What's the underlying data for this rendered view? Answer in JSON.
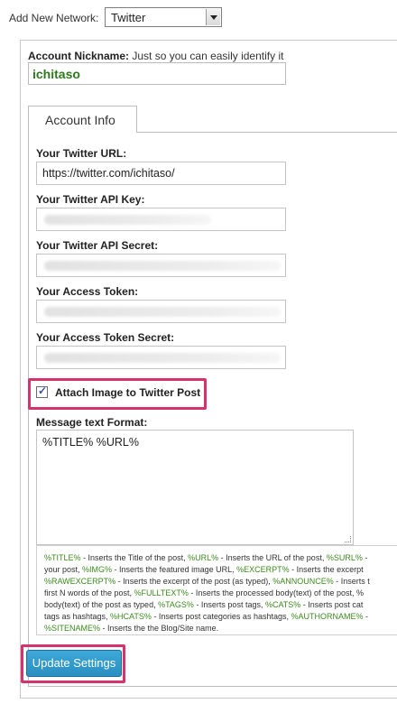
{
  "network": {
    "label": "Add New Network:",
    "selected": "Twitter"
  },
  "nickname": {
    "label_bold": "Account Nickname:",
    "label_rest": " Just so you can easily identify it",
    "value": "ichitaso"
  },
  "tabs": [
    {
      "label": "Account Info"
    }
  ],
  "fields": {
    "twitter_url": {
      "label": "Your Twitter URL:",
      "value": "https://twitter.com/ichitaso/"
    },
    "api_key": {
      "label": "Your Twitter API Key:"
    },
    "api_secret": {
      "label": "Your Twitter API Secret:"
    },
    "access_token": {
      "label": "Your Access Token:"
    },
    "access_token_secret": {
      "label": "Your Access Token Secret:"
    }
  },
  "attach_image": {
    "label": "Attach Image to Twitter Post",
    "checked": true,
    "check_glyph": "✓"
  },
  "message": {
    "label": "Message text Format:",
    "value": "%TITLE%  %URL%"
  },
  "help_lines": [
    [
      {
        "t": "%TITLE%",
        "tk": true
      },
      {
        "t": " - Inserts the Title of the post, "
      },
      {
        "t": "%URL%",
        "tk": true
      },
      {
        "t": " - Inserts the URL of the post, "
      },
      {
        "t": "%SURL%",
        "tk": true
      },
      {
        "t": " - "
      }
    ],
    [
      {
        "t": "your post, "
      },
      {
        "t": "%IMG%",
        "tk": true
      },
      {
        "t": " - Inserts the featured image URL, "
      },
      {
        "t": "%EXCERPT%",
        "tk": true
      },
      {
        "t": " - Inserts the excerpt"
      }
    ],
    [
      {
        "t": "%RAWEXCERPT%",
        "tk": true
      },
      {
        "t": " - Inserts the excerpt of the post (as typed), "
      },
      {
        "t": "%ANNOUNCE%",
        "tk": true
      },
      {
        "t": " - Inserts t"
      }
    ],
    [
      {
        "t": "first N words of the post, "
      },
      {
        "t": "%FULLTEXT%",
        "tk": true
      },
      {
        "t": " - Inserts the processed body(text) of the post, "
      },
      {
        "t": "%"
      }
    ],
    [
      {
        "t": "body(text) of the post as typed, "
      },
      {
        "t": "%TAGS%",
        "tk": true
      },
      {
        "t": " - Inserts post tags, "
      },
      {
        "t": "%CATS%",
        "tk": true
      },
      {
        "t": " - Inserts post cat"
      }
    ],
    [
      {
        "t": "tags as hashtags, "
      },
      {
        "t": "%HCATS%",
        "tk": true
      },
      {
        "t": " - Inserts post categories as hashtags, "
      },
      {
        "t": "%AUTHORNAME%",
        "tk": true
      },
      {
        "t": " -"
      }
    ],
    [
      {
        "t": "%SITENAME%",
        "tk": true
      },
      {
        "t": " - Inserts the the Blog/Site name."
      }
    ]
  ],
  "update_button": {
    "label": "Update Settings"
  },
  "colors": {
    "highlight": "#d6326c",
    "token": "#3c8a1e",
    "button": "#2a8fc2",
    "nickname_text": "#2b7a1b"
  }
}
